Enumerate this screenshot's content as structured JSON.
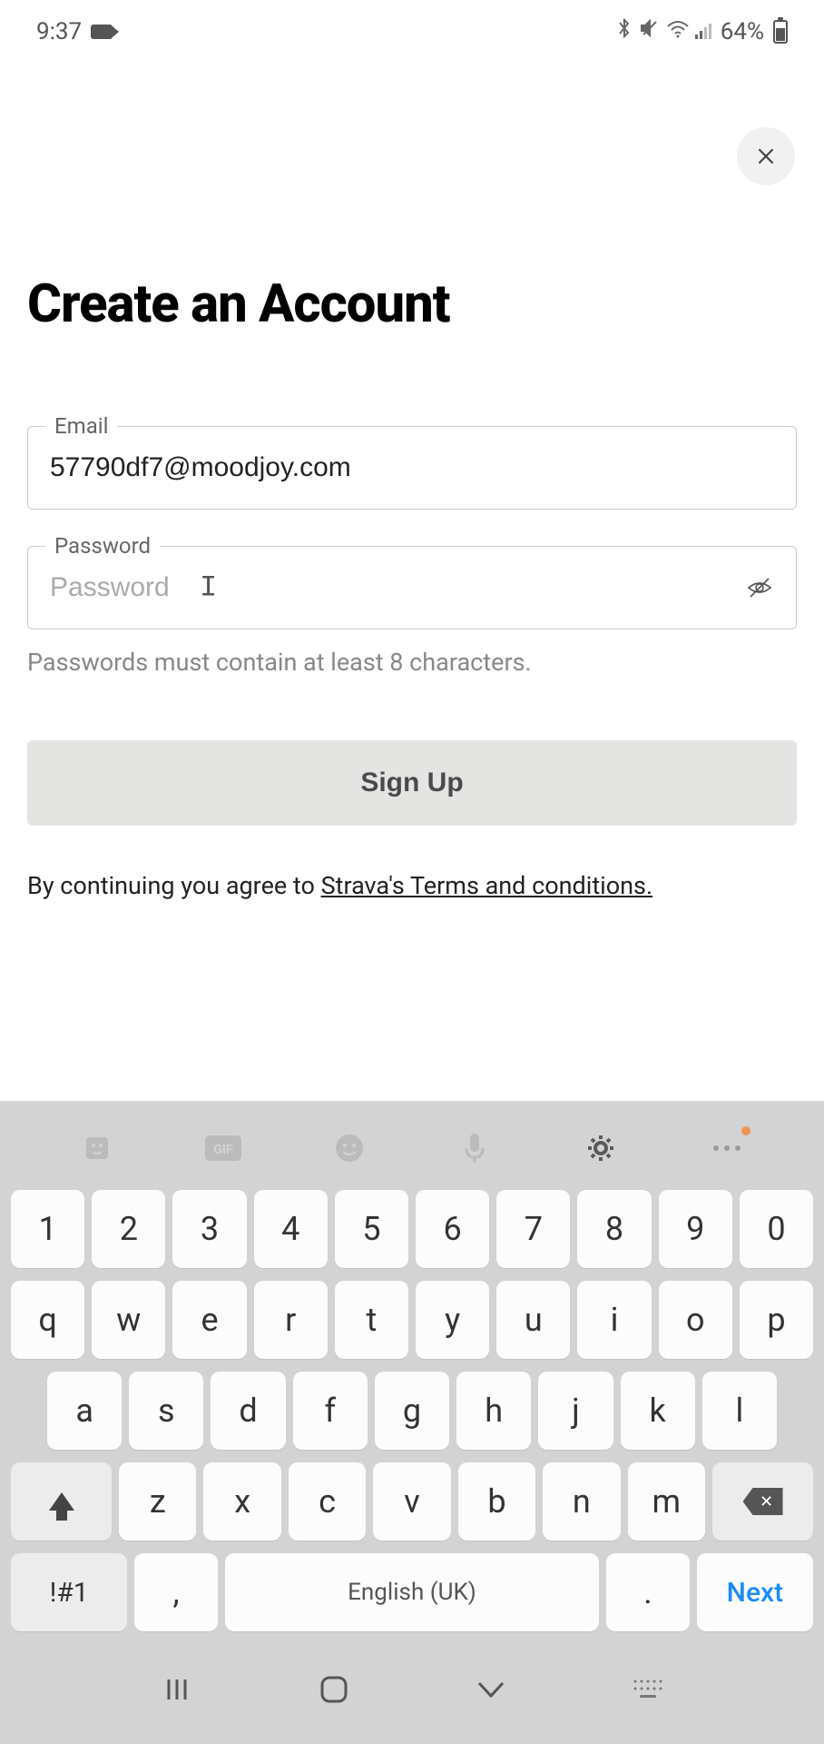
{
  "status": {
    "time": "9:37",
    "battery_pct": "64%"
  },
  "page": {
    "title": "Create an Account",
    "email_label": "Email",
    "email_value": "57790df7@moodjoy.com",
    "password_label": "Password",
    "password_placeholder": "Password",
    "password_helper": "Passwords must contain at least 8 characters.",
    "signup_label": "Sign Up",
    "terms_prefix": "By continuing you agree to ",
    "terms_link": "Strava's Terms and conditions."
  },
  "keyboard": {
    "numbers": [
      "1",
      "2",
      "3",
      "4",
      "5",
      "6",
      "7",
      "8",
      "9",
      "0"
    ],
    "row1": [
      "q",
      "w",
      "e",
      "r",
      "t",
      "y",
      "u",
      "i",
      "o",
      "p"
    ],
    "row2": [
      "a",
      "s",
      "d",
      "f",
      "g",
      "h",
      "j",
      "k",
      "l"
    ],
    "row3": [
      "z",
      "x",
      "c",
      "v",
      "b",
      "n",
      "m"
    ],
    "sym": "!#1",
    "comma": ",",
    "space": "English (UK)",
    "dot": ".",
    "next": "Next",
    "gif_label": "GIF"
  }
}
